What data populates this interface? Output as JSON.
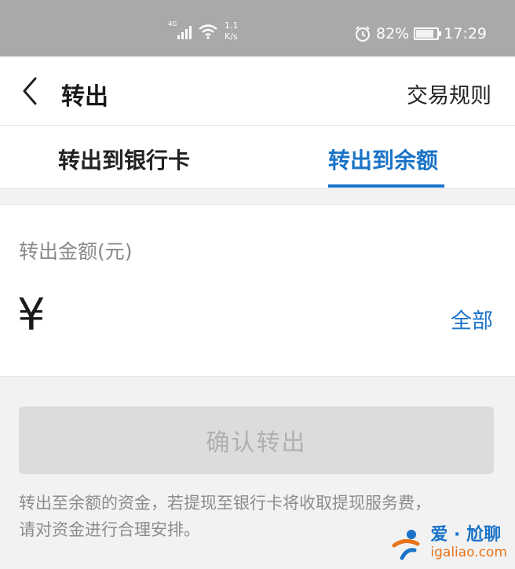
{
  "status_bar": {
    "network_tag": "4G",
    "net_speed_value": "1.1",
    "net_speed_unit": "K/s",
    "battery_percent": "82%",
    "battery_level": 0.82,
    "time": "17:29"
  },
  "nav": {
    "title": "转出",
    "rules_label": "交易规则"
  },
  "tabs": [
    {
      "label": "转出到银行卡",
      "active": false
    },
    {
      "label": "转出到余额",
      "active": true
    }
  ],
  "amount": {
    "label": "转出金额(元)",
    "currency_symbol": "¥",
    "value": "",
    "all_label": "全部"
  },
  "confirm_label": "确认转出",
  "notice": {
    "line1": "转出至余额的资金，若提现至银行卡将收取提现服务费，",
    "line2": "请对资金进行合理安排。"
  },
  "watermark": {
    "title": "爱 · 尬聊",
    "url": "igaliao.com"
  },
  "colors": {
    "accent": "#1a73c8",
    "status_bar_bg": "#a9a9a9",
    "disabled_button_bg": "#dcdcdc",
    "watermark_orange": "#e8731a"
  },
  "icons": [
    "back-arrow-icon",
    "signal-icon",
    "wifi-icon",
    "alarm-icon",
    "battery-icon"
  ]
}
